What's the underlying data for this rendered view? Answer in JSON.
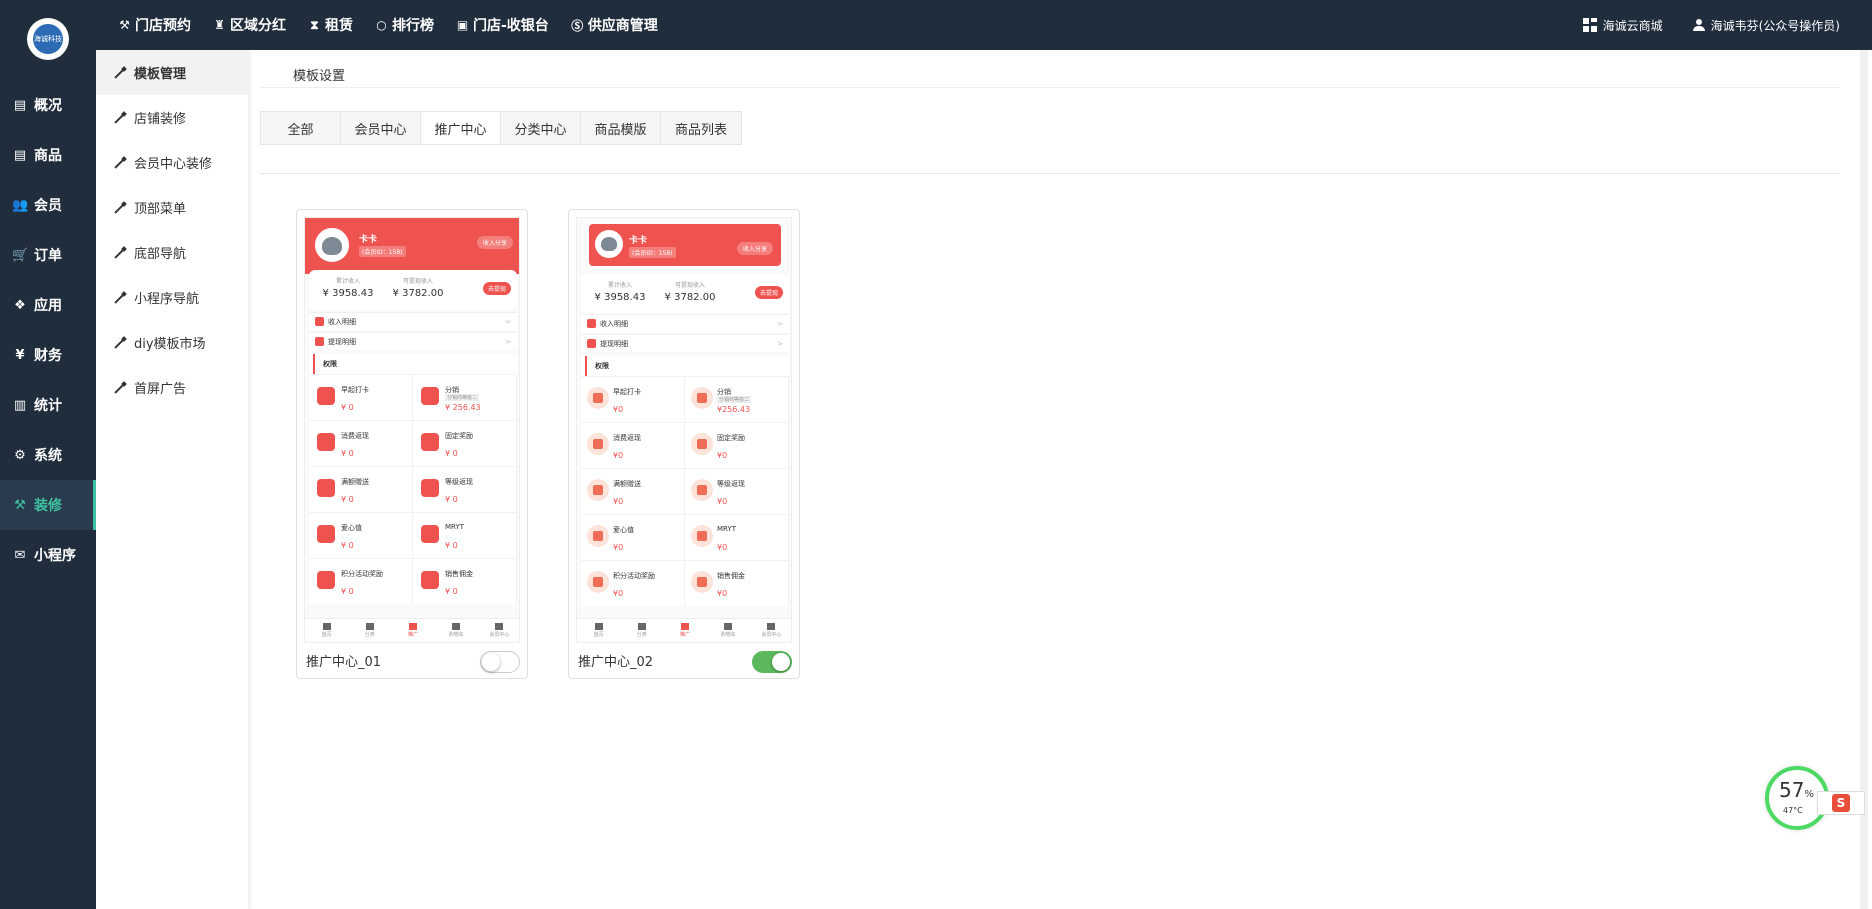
{
  "topnav": [
    {
      "icon": "hammer-icon",
      "glyph": "⚒",
      "label": "门店预约"
    },
    {
      "icon": "torch-icon",
      "glyph": "♜",
      "label": "区域分红"
    },
    {
      "icon": "hourglass-icon",
      "glyph": "⧗",
      "label": "租赁"
    },
    {
      "icon": "circle-icon",
      "glyph": "○",
      "label": "排行榜"
    },
    {
      "icon": "cash-icon",
      "glyph": "▣",
      "label": "门店-收银台"
    },
    {
      "icon": "skype-icon",
      "glyph": "Ⓢ",
      "label": "供应商管理"
    }
  ],
  "topright": {
    "shop_label": "海诚云商城",
    "user_label": "海诚韦芬(公众号操作员)"
  },
  "logo_text": "海诚科技",
  "side_menu": [
    {
      "icon": "archive-icon",
      "glyph": "▤",
      "label": "概况"
    },
    {
      "icon": "archive-icon",
      "glyph": "▤",
      "label": "商品"
    },
    {
      "icon": "users-icon",
      "glyph": "👥",
      "label": "会员"
    },
    {
      "icon": "cart-icon",
      "glyph": "🛒",
      "label": "订单"
    },
    {
      "icon": "cubes-icon",
      "glyph": "❖",
      "label": "应用"
    },
    {
      "icon": "yen-icon",
      "glyph": "¥",
      "label": "财务"
    },
    {
      "icon": "bar-chart-icon",
      "glyph": "▥",
      "label": "统计"
    },
    {
      "icon": "gears-icon",
      "glyph": "⚙",
      "label": "系统"
    },
    {
      "icon": "gavel-icon",
      "glyph": "⚒",
      "label": "装修",
      "active": true
    },
    {
      "icon": "wechat-icon",
      "glyph": "✉",
      "label": "小程序"
    }
  ],
  "sub_menu": [
    {
      "label": "模板管理",
      "active": true
    },
    {
      "label": "店铺装修"
    },
    {
      "label": "会员中心装修"
    },
    {
      "label": "顶部菜单"
    },
    {
      "label": "底部导航"
    },
    {
      "label": "小程序导航"
    },
    {
      "label": "diy模板市场"
    },
    {
      "label": "首屏广告"
    }
  ],
  "section_title": "模板设置",
  "tabs": [
    {
      "label": "全部"
    },
    {
      "label": "会员中心"
    },
    {
      "label": "推广中心",
      "active": true
    },
    {
      "label": "分类中心"
    },
    {
      "label": "商品模版"
    },
    {
      "label": "商品列表"
    }
  ],
  "templates": [
    {
      "name": "推广中心_01",
      "enabled": false,
      "preview": {
        "nickname": "卡卡",
        "member_id": "(会员ID：158)",
        "share": "收入分享",
        "stat1_label": "累计收入",
        "stat1_value": "¥ 3958.43",
        "stat2_label": "可提现收入",
        "stat2_value": "¥ 3782.00",
        "withdraw": "去提现",
        "row1": "收入明细",
        "row2": "提现明细",
        "perm_title": "权限",
        "cells": [
          {
            "title": "早起打卡",
            "value": "¥ 0"
          },
          {
            "title": "分销",
            "sub": "分销商等级二",
            "value": "¥ 256.43"
          },
          {
            "title": "消费返现",
            "value": "¥ 0"
          },
          {
            "title": "固定奖励",
            "value": "¥ 0"
          },
          {
            "title": "满额赠送",
            "value": "¥ 0"
          },
          {
            "title": "等级返现",
            "value": "¥ 0"
          },
          {
            "title": "爱心值",
            "value": "¥ 0"
          },
          {
            "title": "MRYT",
            "value": "¥ 0"
          },
          {
            "title": "积分活动奖励",
            "value": "¥ 0"
          },
          {
            "title": "销售佣金",
            "value": "¥ 0"
          }
        ],
        "tabbar": [
          "首页",
          "分类",
          "推广",
          "购物车",
          "会员中心"
        ]
      }
    },
    {
      "name": "推广中心_02",
      "enabled": true,
      "preview": {
        "nickname": "卡卡",
        "member_id": "(会员ID：158)",
        "share": "收入分享",
        "stat1_label": "累计收入",
        "stat1_value": "¥ 3958.43",
        "stat2_label": "可提现收入",
        "stat2_value": "¥ 3782.00",
        "withdraw": "去提现",
        "row1": "收入明细",
        "row2": "提现明细",
        "perm_title": "权限",
        "cells": [
          {
            "title": "早起打卡",
            "value": "¥0"
          },
          {
            "title": "分销",
            "sub": "分销商等级二",
            "value": "¥256.43"
          },
          {
            "title": "消费返现",
            "value": "¥0"
          },
          {
            "title": "固定奖励",
            "value": "¥0"
          },
          {
            "title": "满额赠送",
            "value": "¥0"
          },
          {
            "title": "等级返现",
            "value": "¥0"
          },
          {
            "title": "爱心值",
            "value": "¥0"
          },
          {
            "title": "MRYT",
            "value": "¥0"
          },
          {
            "title": "积分活动奖励",
            "value": "¥0"
          },
          {
            "title": "销售佣金",
            "value": "¥0"
          }
        ],
        "tabbar": [
          "首页",
          "分类",
          "推广",
          "购物车",
          "会员中心"
        ]
      }
    }
  ],
  "widget": {
    "cpu_percent": "57",
    "percent_sign": "%",
    "temperature": "47°C",
    "ime_label": "S"
  },
  "colors": {
    "dark_nav": "#1f2d3d",
    "accent": "#3fc1a0",
    "brand_red": "#ef5350",
    "toggle_on": "#5cb85c"
  }
}
